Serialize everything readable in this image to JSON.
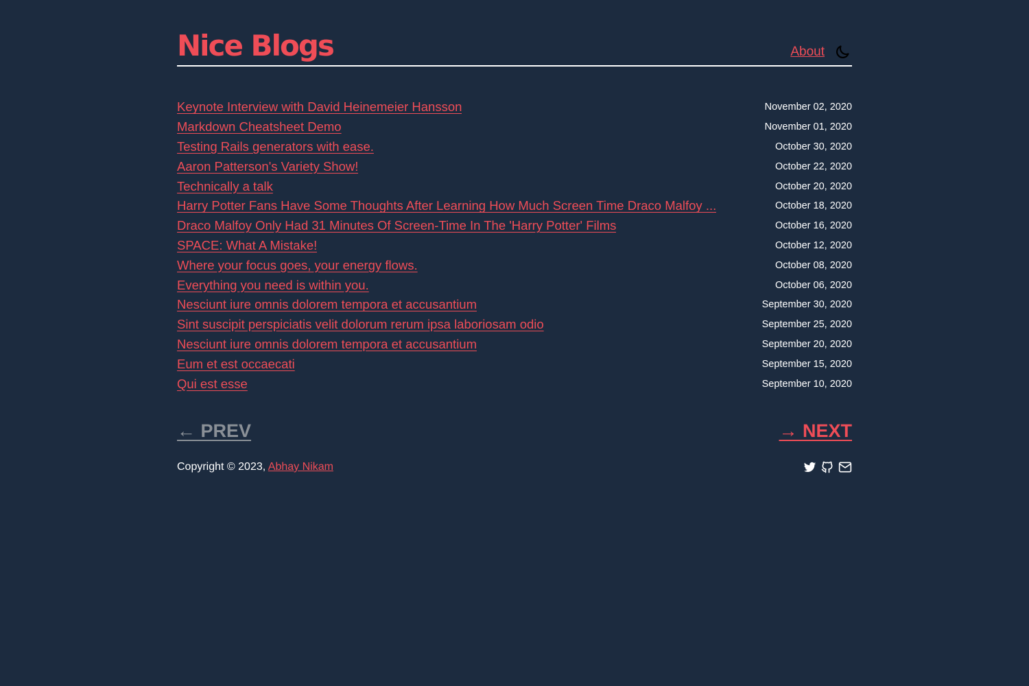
{
  "site": {
    "title": "Nice Blogs",
    "accent_color": "#ef4d57",
    "background_color": "#1c2b3f"
  },
  "nav": {
    "about_label": "About",
    "theme_toggle_icon": "moon-icon"
  },
  "posts": [
    {
      "title": "Keynote Interview with David Heinemeier Hansson",
      "date": "November 02, 2020"
    },
    {
      "title": "Markdown Cheatsheet Demo",
      "date": "November 01, 2020"
    },
    {
      "title": "Testing Rails generators with ease.",
      "date": "October 30, 2020"
    },
    {
      "title": "Aaron Patterson's Variety Show!",
      "date": "October 22, 2020"
    },
    {
      "title": "Technically a talk",
      "date": "October 20, 2020"
    },
    {
      "title": "Harry Potter Fans Have Some Thoughts After Learning How Much Screen Time Draco Malfoy ...",
      "date": "October 18, 2020"
    },
    {
      "title": "Draco Malfoy Only Had 31 Minutes Of Screen-Time In The 'Harry Potter' Films",
      "date": "October 16, 2020"
    },
    {
      "title": "SPACE: What A Mistake!",
      "date": "October 12, 2020"
    },
    {
      "title": "Where your focus goes, your energy flows.",
      "date": "October 08, 2020"
    },
    {
      "title": "Everything you need is within you.",
      "date": "October 06, 2020"
    },
    {
      "title": "Nesciunt iure omnis dolorem tempora et accusantium",
      "date": "September 30, 2020"
    },
    {
      "title": "Sint suscipit perspiciatis velit dolorum rerum ipsa laboriosam odio",
      "date": "September 25, 2020"
    },
    {
      "title": "Nesciunt iure omnis dolorem tempora et accusantium",
      "date": "September 20, 2020"
    },
    {
      "title": "Eum et est occaecati",
      "date": "September 15, 2020"
    },
    {
      "title": "Qui est esse",
      "date": "September 10, 2020"
    }
  ],
  "pagination": {
    "prev_label": "← PREV",
    "next_label": "→ NEXT"
  },
  "footer": {
    "copyright_text": "Copyright © 2023, ",
    "author_name": "Abhay Nikam",
    "social_icons": [
      "twitter-icon",
      "github-icon",
      "mail-icon"
    ]
  }
}
